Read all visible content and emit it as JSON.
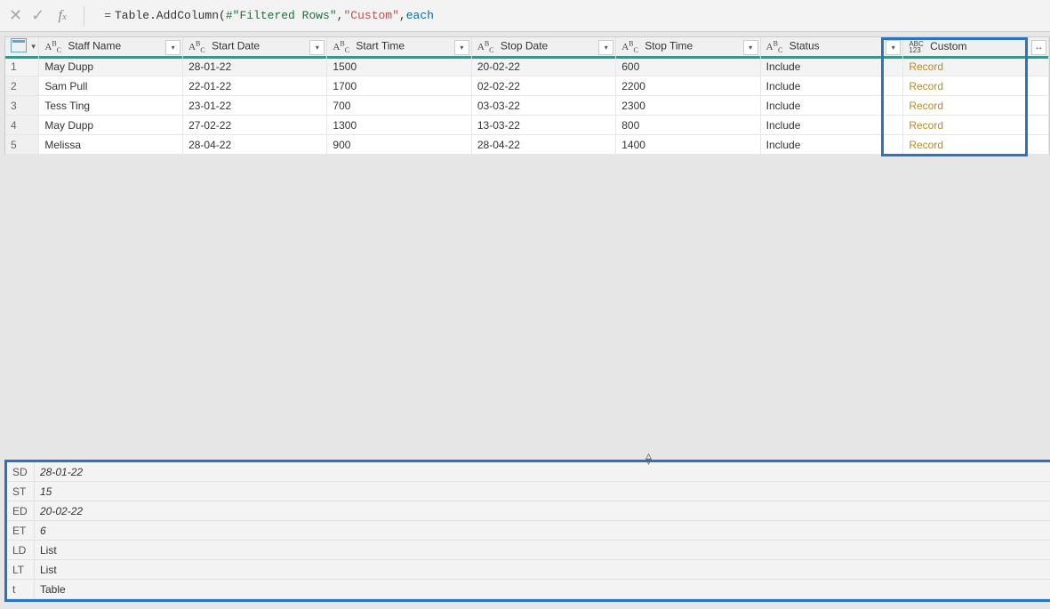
{
  "formula": {
    "prefix": "=",
    "fn": "Table.AddColumn",
    "open": "(",
    "ref": "#\"Filtered Rows\"",
    "sep1": ", ",
    "arg_str": "\"Custom\"",
    "sep2": ", ",
    "kw": "each",
    "tail": ""
  },
  "columns": {
    "staff": "Staff Name",
    "start_date": "Start Date",
    "start_time": "Start Time",
    "stop_date": "Stop Date",
    "stop_time": "Stop Time",
    "status": "Status",
    "custom": "Custom"
  },
  "type_icon": {
    "text": "AᴮC",
    "any_top": "ABC",
    "any_bot": "123"
  },
  "rows": [
    {
      "n": "1",
      "staff": "May Dupp",
      "sd": "28-01-22",
      "st": "1500",
      "ed": "20-02-22",
      "et": "600",
      "status": "Include",
      "custom": "Record"
    },
    {
      "n": "2",
      "staff": "Sam Pull",
      "sd": "22-01-22",
      "st": "1700",
      "ed": "02-02-22",
      "et": "2200",
      "status": "Include",
      "custom": "Record"
    },
    {
      "n": "3",
      "staff": "Tess Ting",
      "sd": "23-01-22",
      "st": "700",
      "ed": "03-03-22",
      "et": "2300",
      "status": "Include",
      "custom": "Record"
    },
    {
      "n": "4",
      "staff": "May Dupp",
      "sd": "27-02-22",
      "st": "1300",
      "ed": "13-03-22",
      "et": "800",
      "status": "Include",
      "custom": "Record"
    },
    {
      "n": "5",
      "staff": "Melissa",
      "sd": "28-04-22",
      "st": "900",
      "ed": "28-04-22",
      "et": "1400",
      "status": "Include",
      "custom": "Record"
    }
  ],
  "preview": {
    "SD": {
      "label": "SD",
      "value": "28-01-22",
      "ital": true
    },
    "ST": {
      "label": "ST",
      "value": "15",
      "ital": true
    },
    "ED": {
      "label": "ED",
      "value": "20-02-22",
      "ital": true
    },
    "ET": {
      "label": "ET",
      "value": "6",
      "ital": true
    },
    "LD": {
      "label": "LD",
      "value": "List",
      "ital": false
    },
    "LT": {
      "label": "LT",
      "value": "List",
      "ital": false
    },
    "t": {
      "label": "t",
      "value": "Table",
      "ital": false
    }
  }
}
